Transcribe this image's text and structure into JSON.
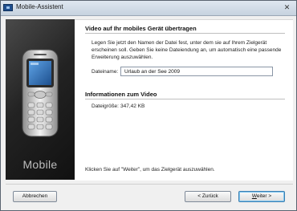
{
  "window": {
    "title": "Mobile-Assistent",
    "close_glyph": "✕"
  },
  "left_panel": {
    "label": "Mobile",
    "phone_screen_color": "#2a6fc2"
  },
  "section1": {
    "title": "Video auf Ihr mobiles Gerät übertragen",
    "description": "Legen Sie jetzt den Namen der Datei fest, unter dem sie auf Ihrem Zielgerät erscheinen soll. Geben Sie keine Dateiendung an, um automatisch eine passende Erweiterung auszuwählen.",
    "filename_label": "Dateiname:",
    "filename_value": "Urlaub an der See 2009"
  },
  "section2": {
    "title": "Informationen zum Video",
    "size_label": "Dateigröße:",
    "size_value": "347,42 KB"
  },
  "hint": "Klicken Sie auf \"Weiter\", um das Zielgerät auszuwählen.",
  "buttons": {
    "cancel": "Abbrechen",
    "back": "< Zurück",
    "next_underlined": "W",
    "next_rest": "eiter >"
  }
}
